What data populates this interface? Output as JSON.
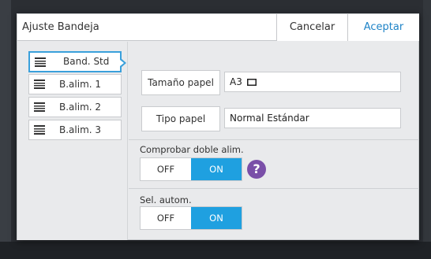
{
  "dialog": {
    "title": "Ajuste Bandeja",
    "cancel_label": "Cancelar",
    "accept_label": "Aceptar"
  },
  "sidebar": {
    "items": [
      {
        "label": "Band. Std",
        "icon": "tray-icon",
        "selected": true
      },
      {
        "label": "B.alim. 1",
        "icon": "tray-icon",
        "selected": false
      },
      {
        "label": "B.alim. 2",
        "icon": "tray-icon",
        "selected": false
      },
      {
        "label": "B.alim. 3",
        "icon": "tray-icon",
        "selected": false
      }
    ]
  },
  "main": {
    "paper_size_label": "Tamaño papel",
    "paper_size_value": "A3",
    "paper_size_orientation_icon": "landscape-icon",
    "paper_type_label": "Tipo papel",
    "paper_type_value": "Normal Estándar",
    "double_feed_label": "Comprobar doble alim.",
    "double_feed_off": "OFF",
    "double_feed_on": "ON",
    "double_feed_state": "ON",
    "help_icon": "question-icon",
    "help_glyph": "?",
    "auto_select_label": "Sel. autom.",
    "auto_select_off": "OFF",
    "auto_select_on": "ON",
    "auto_select_state": "ON"
  },
  "colors": {
    "accent": "#1fa0e0",
    "accept_text": "#1e83c7",
    "help": "#7a4fa8",
    "selected_border": "#3aa0db"
  }
}
